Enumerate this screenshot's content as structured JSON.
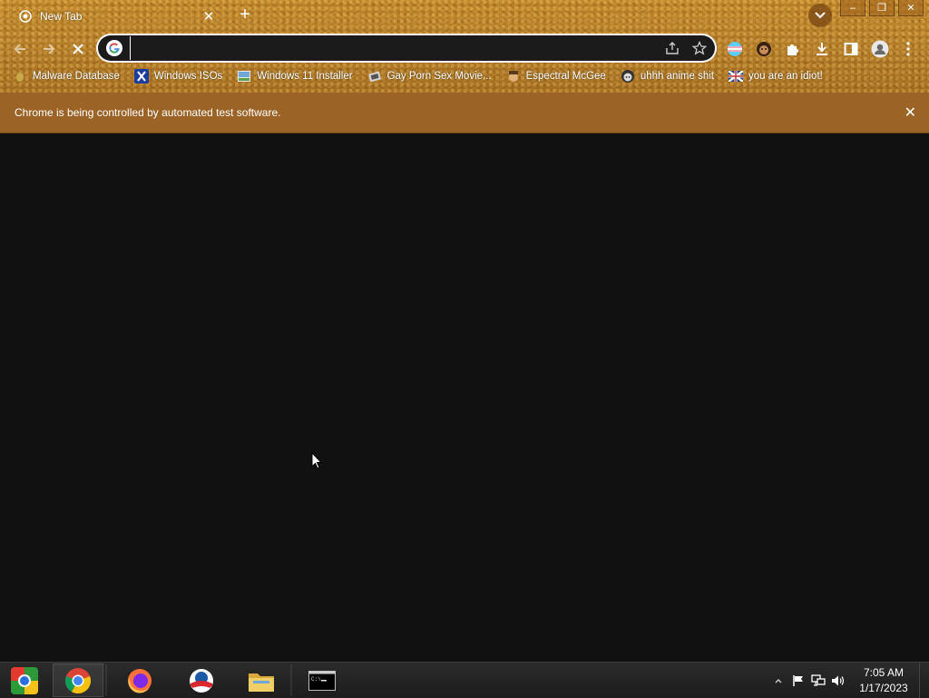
{
  "tab": {
    "title": "New Tab",
    "close": "✕"
  },
  "new_tab": "+",
  "window": {
    "minimize": "–",
    "maximize": "❐",
    "close": "✕"
  },
  "omnibox": {
    "value": "",
    "placeholder": ""
  },
  "bookmarks": [
    {
      "label": "Malware Database",
      "icon": "malware-favicon",
      "color": "#c8a94a"
    },
    {
      "label": "Windows ISOs",
      "icon": "windows-x-favicon",
      "color": "#1a3d9e"
    },
    {
      "label": "Windows 11 Installer",
      "icon": "installer-favicon",
      "color": "#6fa7d9"
    },
    {
      "label": "Gay Porn Sex Movie...",
      "icon": "film-favicon",
      "color": "#d6d6d6"
    },
    {
      "label": "Espectral McGee",
      "icon": "character-favicon",
      "color": "#e0b07a"
    },
    {
      "label": "uhhh anime shit",
      "icon": "anime-favicon",
      "color": "#dddddd"
    },
    {
      "label": "you are an idiot!",
      "icon": "flag-favicon",
      "color": "#c03030"
    }
  ],
  "infobar": {
    "message": "Chrome is being controlled by automated test software.",
    "close": "✕"
  },
  "clock": {
    "time": "7:05 AM",
    "date": "1/17/2023"
  },
  "colors": {
    "frame": "#b8802a",
    "infobar": "#9b6326",
    "content": "#111111",
    "taskbar": "#1d1d1d"
  }
}
